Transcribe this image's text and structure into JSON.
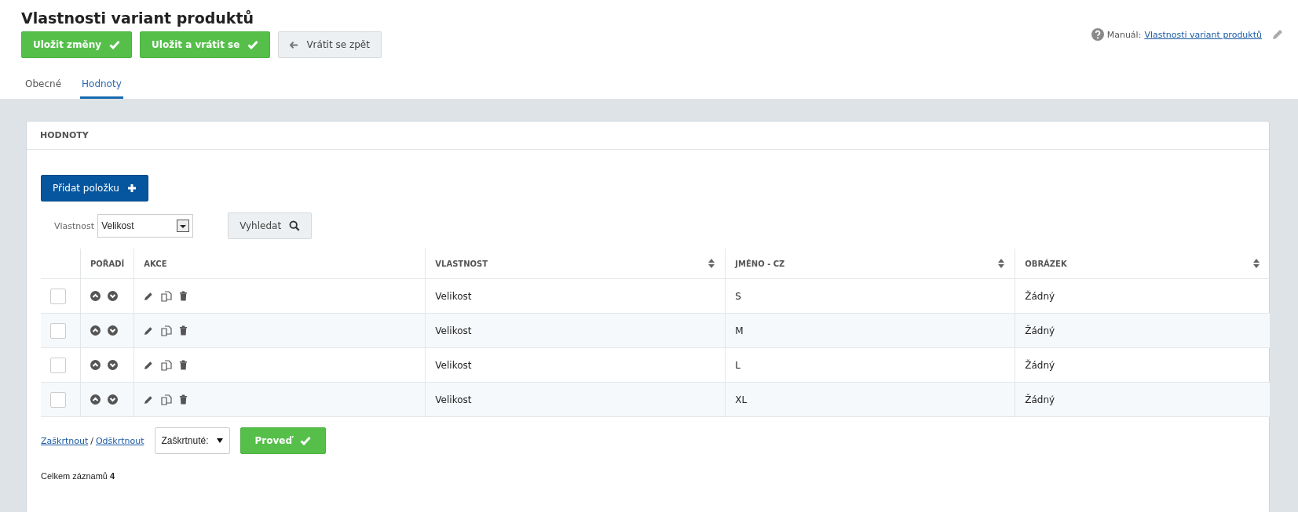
{
  "title": "Vlastnosti variant produktů",
  "actions": [
    {
      "label": "Uložit změny",
      "kind": "save"
    },
    {
      "label": "Uložit a vrátit se",
      "kind": "save"
    },
    {
      "label": "Vrátit se zpět",
      "kind": "back"
    }
  ],
  "manual": {
    "label": "Manuál:",
    "link": "Vlastnosti variant produktů"
  },
  "tabs": [
    {
      "label": "Obecné",
      "selected": false
    },
    {
      "label": "Hodnoty",
      "selected": true
    }
  ],
  "panel": {
    "title": "HODNOTY",
    "add_button": "Přidat položku",
    "filter": {
      "label": "Vlastnost",
      "value": "Velikost",
      "search_button": "Vyhledat"
    },
    "table": {
      "columns": [
        {
          "label": "POŘADÍ",
          "kind": "plain"
        },
        {
          "label": "AKCE",
          "kind": "plain"
        },
        {
          "label": "VLASTNOST",
          "kind": "sortable"
        },
        {
          "label": "JMÉNO - CZ",
          "kind": "sortable"
        },
        {
          "label": "OBRÁZEK",
          "kind": "sortable"
        }
      ],
      "rows": [
        {
          "checked": false,
          "property": "Velikost",
          "name": "S",
          "image": "Žádný"
        },
        {
          "checked": false,
          "property": "Velikost",
          "name": "M",
          "image": "Žádný"
        },
        {
          "checked": false,
          "property": "Velikost",
          "name": "L",
          "image": "Žádný"
        },
        {
          "checked": false,
          "property": "Velikost",
          "name": "XL",
          "image": "Žádný"
        }
      ]
    },
    "bulk": {
      "check_all": "Zaškrtnout",
      "separator": "/",
      "uncheck_all": "Odškrtnout",
      "select_value": "Zaškrtnuté:",
      "run_button": "Proveď"
    },
    "total": {
      "label": "Celkem záznamů",
      "count": "4"
    }
  }
}
